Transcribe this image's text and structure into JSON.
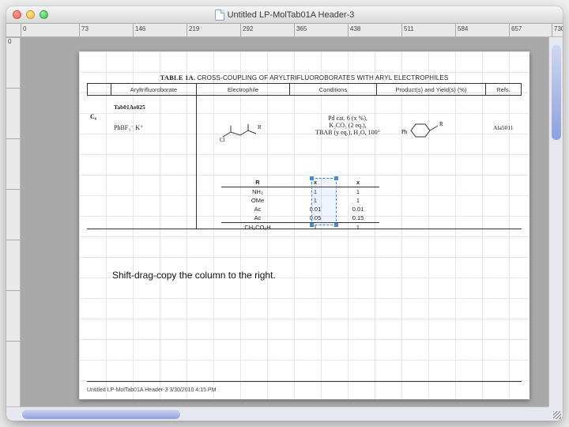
{
  "window": {
    "title": "Untitled LP-MolTab01A Header-3"
  },
  "ruler_h": [
    {
      "pos": 18,
      "label": "0"
    },
    {
      "pos": 92,
      "label": "73"
    },
    {
      "pos": 160,
      "label": "146"
    },
    {
      "pos": 228,
      "label": "219"
    },
    {
      "pos": 296,
      "label": "292"
    },
    {
      "pos": 364,
      "label": "365"
    },
    {
      "pos": 432,
      "label": "438"
    },
    {
      "pos": 500,
      "label": "511"
    },
    {
      "pos": 568,
      "label": "584"
    },
    {
      "pos": 636,
      "label": "657"
    },
    {
      "pos": 690,
      "label": "730"
    }
  ],
  "ruler_v": [
    {
      "pos": 0,
      "label": "0"
    },
    {
      "pos": 64,
      "label": ""
    },
    {
      "pos": 128,
      "label": ""
    },
    {
      "pos": 192,
      "label": ""
    },
    {
      "pos": 256,
      "label": ""
    },
    {
      "pos": 320,
      "label": ""
    },
    {
      "pos": 384,
      "label": ""
    }
  ],
  "table": {
    "caption_b": "TABLE 1A.",
    "caption_rest": " CROSS-COUPLING OF ARYLTRIFLUOROBORATES WITH ARYL ELECTROPHILES",
    "headers": {
      "c0": "",
      "c1": "Aryltrifluoroborate",
      "c2": "Electrophile",
      "c3": "Conditions",
      "c4": "Product(s) and Yield(s) (%)",
      "c5": "Refs."
    }
  },
  "entry": {
    "group": "C₆",
    "code": "Tab01Ae025",
    "borate": "PhBF₃⁻ K⁺",
    "electrophile_sub": "R",
    "conditions_l1": "Pd cat. 6 (x %),",
    "conditions_l2": "K₂CO₃ (2 eq.),",
    "conditions_l3": "TBAB (y eq.), H₂O, 100°",
    "product_prefix": "Ph",
    "product_sub": "R",
    "ref": "Ala5011"
  },
  "subtable": {
    "headers": [
      "R",
      "x",
      "x"
    ],
    "rows": [
      [
        "NH₂",
        "1",
        "1"
      ],
      [
        "OMe",
        "1",
        "1"
      ],
      [
        "Ac",
        "0.01",
        "0.01"
      ],
      [
        "Ac",
        "0.05",
        "0.15"
      ],
      [
        "CH₂CO₂H",
        "1",
        "1"
      ]
    ]
  },
  "instruction": "Shift-drag-copy the column to the right.",
  "footer": "Untitled LP-MolTab01A Header-3 3/30/2010 4:15 PM"
}
